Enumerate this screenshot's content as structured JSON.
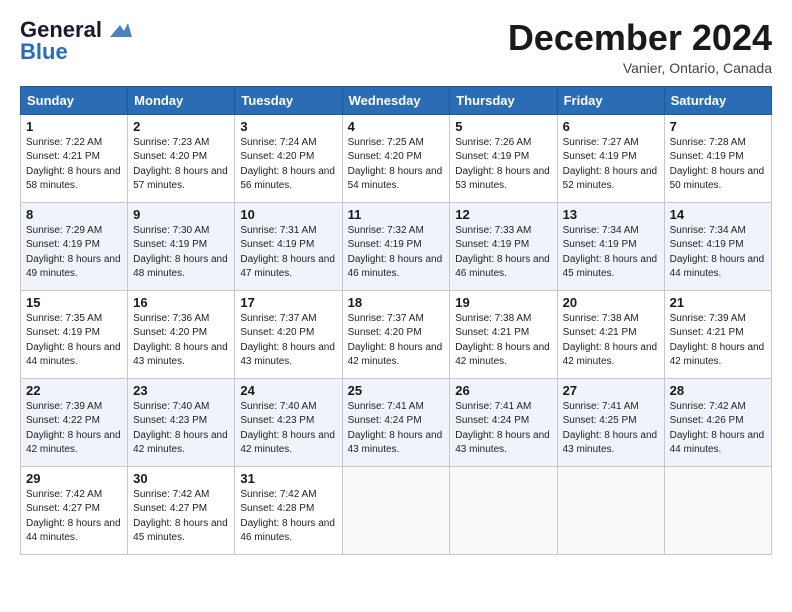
{
  "header": {
    "logo_line1": "General",
    "logo_line2": "Blue",
    "month_title": "December 2024",
    "location": "Vanier, Ontario, Canada"
  },
  "weekdays": [
    "Sunday",
    "Monday",
    "Tuesday",
    "Wednesday",
    "Thursday",
    "Friday",
    "Saturday"
  ],
  "weeks": [
    [
      {
        "day": "1",
        "sunrise": "Sunrise: 7:22 AM",
        "sunset": "Sunset: 4:21 PM",
        "daylight": "Daylight: 8 hours and 58 minutes."
      },
      {
        "day": "2",
        "sunrise": "Sunrise: 7:23 AM",
        "sunset": "Sunset: 4:20 PM",
        "daylight": "Daylight: 8 hours and 57 minutes."
      },
      {
        "day": "3",
        "sunrise": "Sunrise: 7:24 AM",
        "sunset": "Sunset: 4:20 PM",
        "daylight": "Daylight: 8 hours and 56 minutes."
      },
      {
        "day": "4",
        "sunrise": "Sunrise: 7:25 AM",
        "sunset": "Sunset: 4:20 PM",
        "daylight": "Daylight: 8 hours and 54 minutes."
      },
      {
        "day": "5",
        "sunrise": "Sunrise: 7:26 AM",
        "sunset": "Sunset: 4:19 PM",
        "daylight": "Daylight: 8 hours and 53 minutes."
      },
      {
        "day": "6",
        "sunrise": "Sunrise: 7:27 AM",
        "sunset": "Sunset: 4:19 PM",
        "daylight": "Daylight: 8 hours and 52 minutes."
      },
      {
        "day": "7",
        "sunrise": "Sunrise: 7:28 AM",
        "sunset": "Sunset: 4:19 PM",
        "daylight": "Daylight: 8 hours and 50 minutes."
      }
    ],
    [
      {
        "day": "8",
        "sunrise": "Sunrise: 7:29 AM",
        "sunset": "Sunset: 4:19 PM",
        "daylight": "Daylight: 8 hours and 49 minutes."
      },
      {
        "day": "9",
        "sunrise": "Sunrise: 7:30 AM",
        "sunset": "Sunset: 4:19 PM",
        "daylight": "Daylight: 8 hours and 48 minutes."
      },
      {
        "day": "10",
        "sunrise": "Sunrise: 7:31 AM",
        "sunset": "Sunset: 4:19 PM",
        "daylight": "Daylight: 8 hours and 47 minutes."
      },
      {
        "day": "11",
        "sunrise": "Sunrise: 7:32 AM",
        "sunset": "Sunset: 4:19 PM",
        "daylight": "Daylight: 8 hours and 46 minutes."
      },
      {
        "day": "12",
        "sunrise": "Sunrise: 7:33 AM",
        "sunset": "Sunset: 4:19 PM",
        "daylight": "Daylight: 8 hours and 46 minutes."
      },
      {
        "day": "13",
        "sunrise": "Sunrise: 7:34 AM",
        "sunset": "Sunset: 4:19 PM",
        "daylight": "Daylight: 8 hours and 45 minutes."
      },
      {
        "day": "14",
        "sunrise": "Sunrise: 7:34 AM",
        "sunset": "Sunset: 4:19 PM",
        "daylight": "Daylight: 8 hours and 44 minutes."
      }
    ],
    [
      {
        "day": "15",
        "sunrise": "Sunrise: 7:35 AM",
        "sunset": "Sunset: 4:19 PM",
        "daylight": "Daylight: 8 hours and 44 minutes."
      },
      {
        "day": "16",
        "sunrise": "Sunrise: 7:36 AM",
        "sunset": "Sunset: 4:20 PM",
        "daylight": "Daylight: 8 hours and 43 minutes."
      },
      {
        "day": "17",
        "sunrise": "Sunrise: 7:37 AM",
        "sunset": "Sunset: 4:20 PM",
        "daylight": "Daylight: 8 hours and 43 minutes."
      },
      {
        "day": "18",
        "sunrise": "Sunrise: 7:37 AM",
        "sunset": "Sunset: 4:20 PM",
        "daylight": "Daylight: 8 hours and 42 minutes."
      },
      {
        "day": "19",
        "sunrise": "Sunrise: 7:38 AM",
        "sunset": "Sunset: 4:21 PM",
        "daylight": "Daylight: 8 hours and 42 minutes."
      },
      {
        "day": "20",
        "sunrise": "Sunrise: 7:38 AM",
        "sunset": "Sunset: 4:21 PM",
        "daylight": "Daylight: 8 hours and 42 minutes."
      },
      {
        "day": "21",
        "sunrise": "Sunrise: 7:39 AM",
        "sunset": "Sunset: 4:21 PM",
        "daylight": "Daylight: 8 hours and 42 minutes."
      }
    ],
    [
      {
        "day": "22",
        "sunrise": "Sunrise: 7:39 AM",
        "sunset": "Sunset: 4:22 PM",
        "daylight": "Daylight: 8 hours and 42 minutes."
      },
      {
        "day": "23",
        "sunrise": "Sunrise: 7:40 AM",
        "sunset": "Sunset: 4:23 PM",
        "daylight": "Daylight: 8 hours and 42 minutes."
      },
      {
        "day": "24",
        "sunrise": "Sunrise: 7:40 AM",
        "sunset": "Sunset: 4:23 PM",
        "daylight": "Daylight: 8 hours and 42 minutes."
      },
      {
        "day": "25",
        "sunrise": "Sunrise: 7:41 AM",
        "sunset": "Sunset: 4:24 PM",
        "daylight": "Daylight: 8 hours and 43 minutes."
      },
      {
        "day": "26",
        "sunrise": "Sunrise: 7:41 AM",
        "sunset": "Sunset: 4:24 PM",
        "daylight": "Daylight: 8 hours and 43 minutes."
      },
      {
        "day": "27",
        "sunrise": "Sunrise: 7:41 AM",
        "sunset": "Sunset: 4:25 PM",
        "daylight": "Daylight: 8 hours and 43 minutes."
      },
      {
        "day": "28",
        "sunrise": "Sunrise: 7:42 AM",
        "sunset": "Sunset: 4:26 PM",
        "daylight": "Daylight: 8 hours and 44 minutes."
      }
    ],
    [
      {
        "day": "29",
        "sunrise": "Sunrise: 7:42 AM",
        "sunset": "Sunset: 4:27 PM",
        "daylight": "Daylight: 8 hours and 44 minutes."
      },
      {
        "day": "30",
        "sunrise": "Sunrise: 7:42 AM",
        "sunset": "Sunset: 4:27 PM",
        "daylight": "Daylight: 8 hours and 45 minutes."
      },
      {
        "day": "31",
        "sunrise": "Sunrise: 7:42 AM",
        "sunset": "Sunset: 4:28 PM",
        "daylight": "Daylight: 8 hours and 46 minutes."
      },
      null,
      null,
      null,
      null
    ]
  ]
}
